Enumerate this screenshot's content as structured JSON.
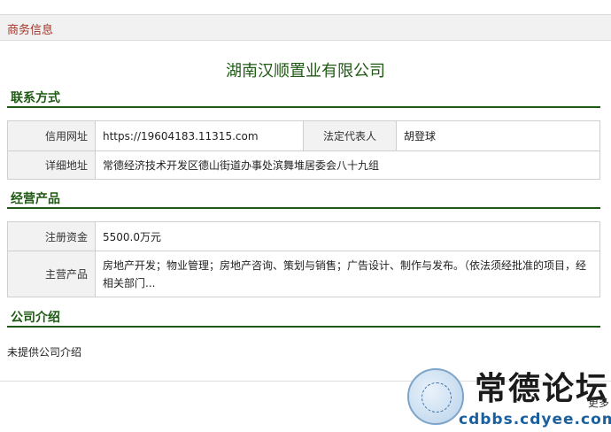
{
  "header": {
    "title": "商务信息"
  },
  "company_name": "湖南汉顺置业有限公司",
  "contact": {
    "heading": "联系方式",
    "website_label": "信用网址",
    "website_value": "https://19604183.11315.com",
    "legal_rep_label": "法定代表人",
    "legal_rep_value": "胡登球",
    "address_label": "详细地址",
    "address_value": "常德经济技术开发区德山街道办事处滨舞堆居委会八十九组"
  },
  "products": {
    "heading": "经营产品",
    "capital_label": "注册资金",
    "capital_value": "5500.0万元",
    "main_label": "主营产品",
    "main_value": "房地产开发；物业管理；房地产咨询、策划与销售；广告设计、制作与发布。（依法须经批准的项目，经相关部门..."
  },
  "intro": {
    "heading": "公司介绍",
    "text": "未提供公司介绍"
  },
  "watermark": {
    "title": "常德论坛",
    "url": "cdbbs.cdyee.com"
  },
  "more_label": "更多"
}
